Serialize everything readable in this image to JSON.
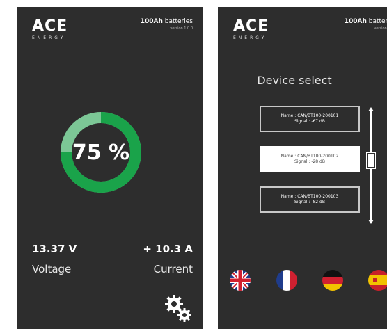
{
  "brand": {
    "logo_main": "ACE",
    "logo_sub": "ENERGY",
    "title_bold": "100Ah",
    "title_rest": " batteries",
    "version": "version 1.0.0"
  },
  "dashboard": {
    "charge_percent": 75,
    "charge_label": "75 %",
    "voltage_value": "13.37 V",
    "voltage_label": "Voltage",
    "current_value": "+ 10.3 A",
    "current_label": "Current"
  },
  "device_select": {
    "title": "Device select",
    "devices": [
      {
        "name": "Name : CAN/BT100-200101",
        "signal": "Signal : -67 dB",
        "selected": false
      },
      {
        "name": "Name : CAN/BT100-200102",
        "signal": "Signal : -28 dB",
        "selected": true
      },
      {
        "name": "Name : CAN/BT100-200103",
        "signal": "Signal : -82 dB",
        "selected": false
      }
    ],
    "languages": [
      "uk-flag-icon",
      "france-flag-icon",
      "germany-flag-icon",
      "spain-flag-icon"
    ]
  },
  "colors": {
    "screen_bg": "#2d2d2d",
    "gauge_green": "#1aa34a",
    "gauge_light": "#7cc796",
    "text": "#ffffff"
  }
}
